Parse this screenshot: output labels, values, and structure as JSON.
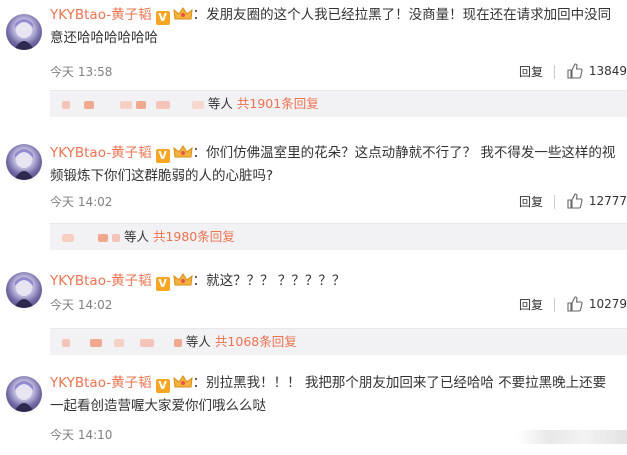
{
  "comments": [
    {
      "user": "YKYBtao-黄子韬",
      "text": "：发朋友圈的这个人我已经拉黑了！没商量！现在还在请求加回中没同意还哈哈哈哈哈哈",
      "time": "今天 13:58",
      "reply": "回复",
      "likes": "13849",
      "sub_suffix": "等人",
      "sub_count": "共1901条回复"
    },
    {
      "user": "YKYBtao-黄子韬",
      "text": "：你们仿佛温室里的花朵？这点动静就不行了？ 我不得发一些这样的视频锻炼下你们这群脆弱的人的心脏吗?",
      "time": "今天 14:02",
      "reply": "回复",
      "likes": "12777",
      "sub_suffix": "等人",
      "sub_count": "共1980条回复"
    },
    {
      "user": "YKYBtao-黄子韬",
      "text": "：就这？？？ ？？？？？",
      "time": "今天 14:02",
      "reply": "回复",
      "likes": "10279",
      "sub_suffix": "等人",
      "sub_count": "共1068条回复"
    },
    {
      "user": "YKYBtao-黄子韬",
      "text": "：别拉黑我！！！ 我把那个朋友加回来了已经哈哈 不要拉黑晚上还要一起看创造营喔大家爱你们哦么么哒",
      "time": "今天 14:10",
      "reply": "",
      "likes": ""
    }
  ],
  "icons": {
    "verified": "V",
    "crown": "crown-icon",
    "like": "thumbs-up-icon"
  },
  "colors": {
    "username": "#eb7350",
    "reply_count": "#eb7350",
    "meta": "#808080",
    "sub_bg": "#f2f2f5"
  }
}
